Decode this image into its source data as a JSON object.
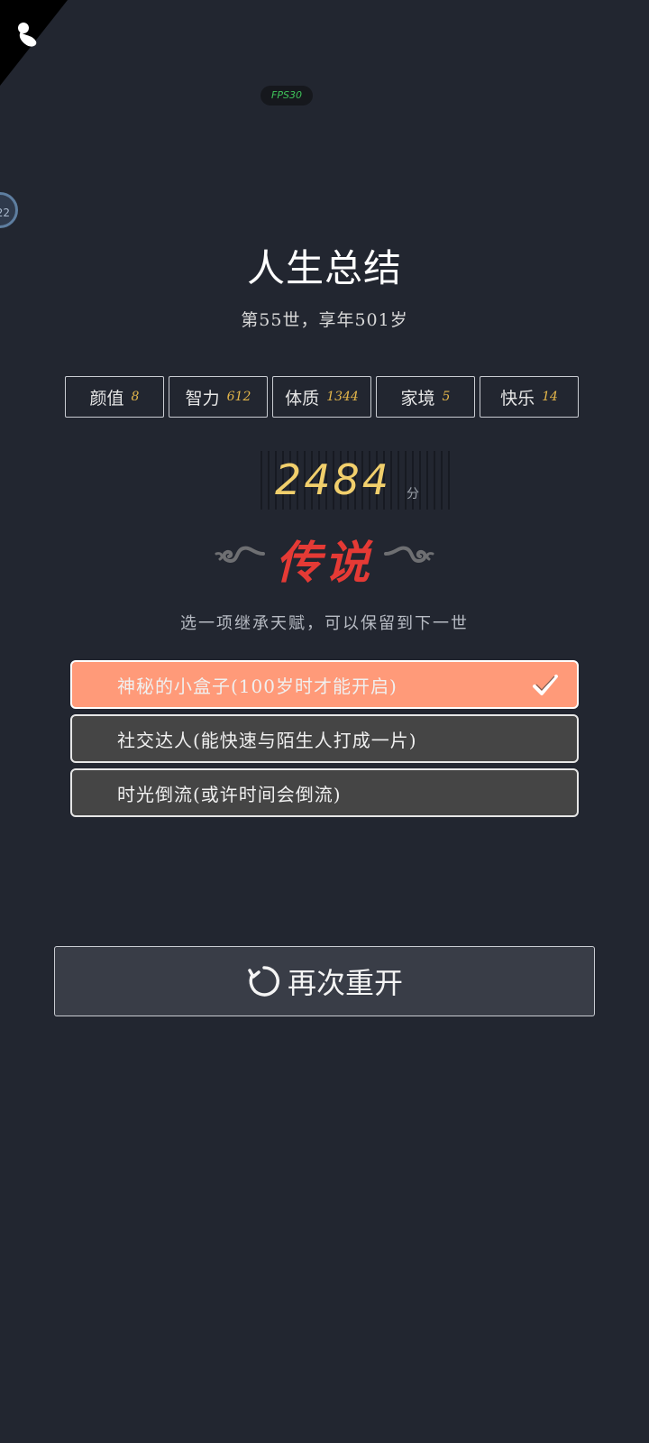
{
  "fps_label": "FPS30",
  "side_badge": "22",
  "title": "人生总结",
  "subtitle": "第55世，享年501岁",
  "stats": [
    {
      "label": "颜值",
      "value": "8"
    },
    {
      "label": "智力",
      "value": "612"
    },
    {
      "label": "体质",
      "value": "1344"
    },
    {
      "label": "家境",
      "value": "5"
    },
    {
      "label": "快乐",
      "value": "14"
    }
  ],
  "score": {
    "value": "2484",
    "unit": "分"
  },
  "grade": "传说",
  "hint": "选一项继承天赋，可以保留到下一世",
  "options": [
    {
      "label": "神秘的小盒子(100岁时才能开启)",
      "selected": true
    },
    {
      "label": "社交达人(能快速与陌生人打成一片)",
      "selected": false
    },
    {
      "label": "时光倒流(或许时间会倒流)",
      "selected": false
    }
  ],
  "restart_label": "再次重开",
  "colors": {
    "background": "#222630",
    "selected_option": "#ff9a79",
    "option": "#454545",
    "score": "#f1cf6c",
    "grade": "#e53a35",
    "stat_value": "#e4b64a"
  },
  "icons": {
    "corner": "person-icon",
    "check": "check-icon",
    "restart": "refresh-icon",
    "decor": "cloud-icon"
  }
}
